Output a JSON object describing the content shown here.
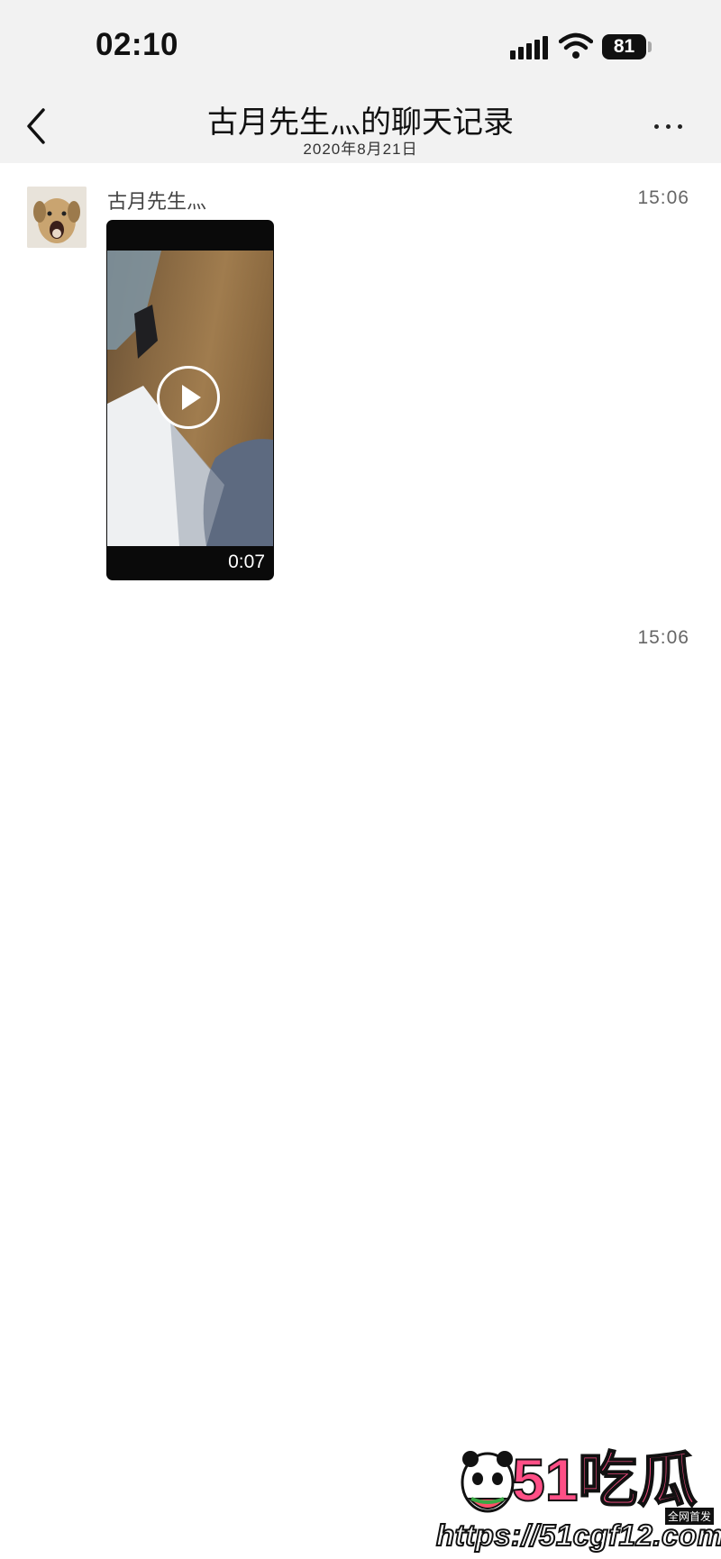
{
  "status_bar": {
    "time": "02:10",
    "battery": "81"
  },
  "nav": {
    "title": "古月先生灬的聊天记录",
    "subtitle": "2020年8月21日"
  },
  "messages": [
    {
      "sender": "古月先生灬",
      "time": "15:06",
      "video_duration": "0:07"
    },
    {
      "time": "15:06"
    }
  ],
  "watermark": {
    "brand": "51吃瓜",
    "tag": "全网首发",
    "url": "https://51cgf12.com"
  },
  "colors": {
    "header_bg": "#f2f2f2",
    "brand_pink": "#ff4f86"
  },
  "icons": [
    "back-chevron",
    "more-dots",
    "play",
    "signal",
    "wifi",
    "battery"
  ]
}
